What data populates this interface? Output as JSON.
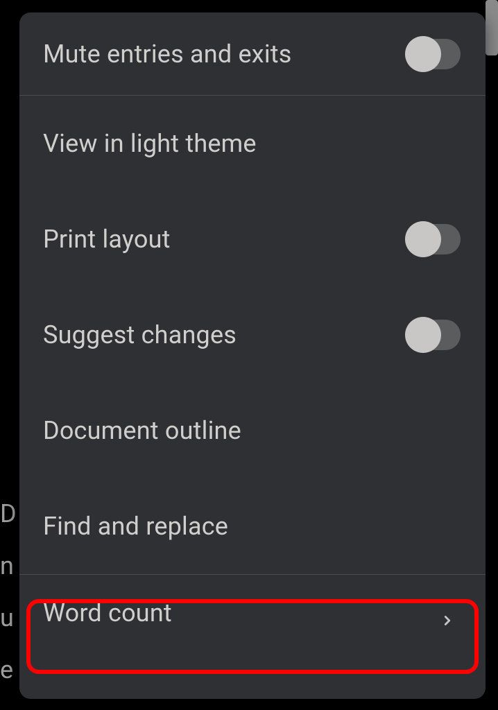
{
  "backdrop": {
    "fragments": [
      "D",
      "n",
      "u",
      "e"
    ]
  },
  "menu": {
    "items": [
      {
        "label": "Mute entries and exits",
        "hasToggle": true,
        "toggleOn": false
      },
      {
        "label": "View in light theme",
        "hasToggle": false
      },
      {
        "label": "Print layout",
        "hasToggle": true,
        "toggleOn": false
      },
      {
        "label": "Suggest changes",
        "hasToggle": true,
        "toggleOn": false
      },
      {
        "label": "Document outline",
        "hasToggle": false
      },
      {
        "label": "Find and replace",
        "hasToggle": false
      },
      {
        "label": "Word count",
        "hasToggle": false,
        "hasChevron": true
      }
    ]
  }
}
